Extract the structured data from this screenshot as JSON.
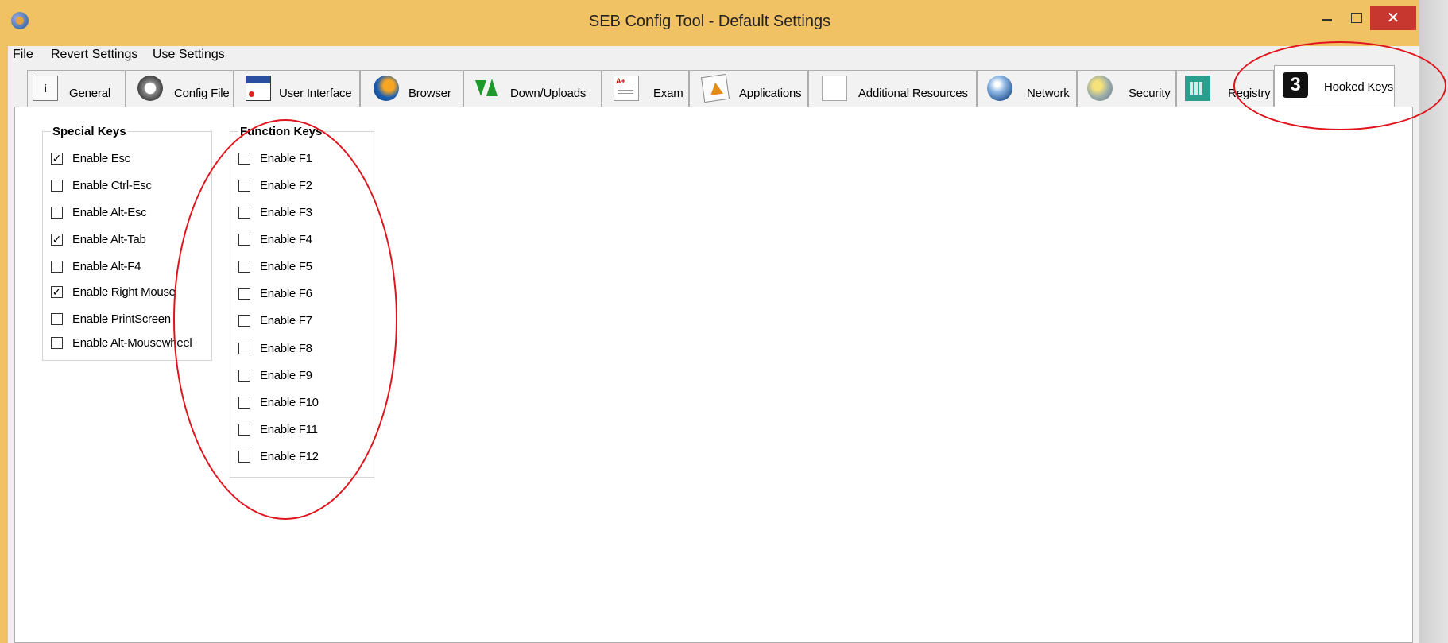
{
  "window": {
    "title": "SEB Config Tool - Default Settings",
    "close_glyph": "✕"
  },
  "menu": [
    "File",
    "Revert Settings",
    "Use Settings"
  ],
  "tabs": [
    {
      "label": "General",
      "icon": "info-icon"
    },
    {
      "label": "Config File",
      "icon": "config-file-icon"
    },
    {
      "label": "User Interface",
      "icon": "user-interface-icon"
    },
    {
      "label": "Browser",
      "icon": "browser-icon"
    },
    {
      "label": "Down/Uploads",
      "icon": "down-uploads-icon"
    },
    {
      "label": "Exam",
      "icon": "exam-icon"
    },
    {
      "label": "Applications",
      "icon": "applications-icon"
    },
    {
      "label": "Additional Resources",
      "icon": "document-icon"
    },
    {
      "label": "Network",
      "icon": "globe-icon"
    },
    {
      "label": "Security",
      "icon": "security-icon"
    },
    {
      "label": "Registry",
      "icon": "registry-icon"
    },
    {
      "label": "Hooked Keys",
      "icon": "hooked-keys-icon",
      "active": true
    }
  ],
  "special_keys": {
    "title": "Special Keys",
    "items": [
      {
        "label": "Enable Esc",
        "checked": true
      },
      {
        "label": "Enable Ctrl-Esc",
        "checked": false
      },
      {
        "label": "Enable Alt-Esc",
        "checked": false
      },
      {
        "label": "Enable Alt-Tab",
        "checked": true
      },
      {
        "label": "Enable Alt-F4",
        "checked": false
      },
      {
        "label": "Enable Right Mouse",
        "checked": true
      },
      {
        "label": "Enable PrintScreen",
        "checked": false
      },
      {
        "label": "Enable Alt-Mousewheel",
        "checked": false
      }
    ]
  },
  "function_keys": {
    "title": "Function Keys",
    "items": [
      {
        "label": "Enable F1",
        "checked": false
      },
      {
        "label": "Enable F2",
        "checked": false
      },
      {
        "label": "Enable F3",
        "checked": false
      },
      {
        "label": "Enable F4",
        "checked": false
      },
      {
        "label": "Enable F5",
        "checked": false
      },
      {
        "label": "Enable F6",
        "checked": false
      },
      {
        "label": "Enable F7",
        "checked": false
      },
      {
        "label": "Enable F8",
        "checked": false
      },
      {
        "label": "Enable F9",
        "checked": false
      },
      {
        "label": "Enable F10",
        "checked": false
      },
      {
        "label": "Enable F11",
        "checked": false
      },
      {
        "label": "Enable F12",
        "checked": false
      }
    ]
  },
  "colors": {
    "title_bar": "#f0c264",
    "close_button": "#c7372f",
    "annotation": "#e0141c"
  }
}
